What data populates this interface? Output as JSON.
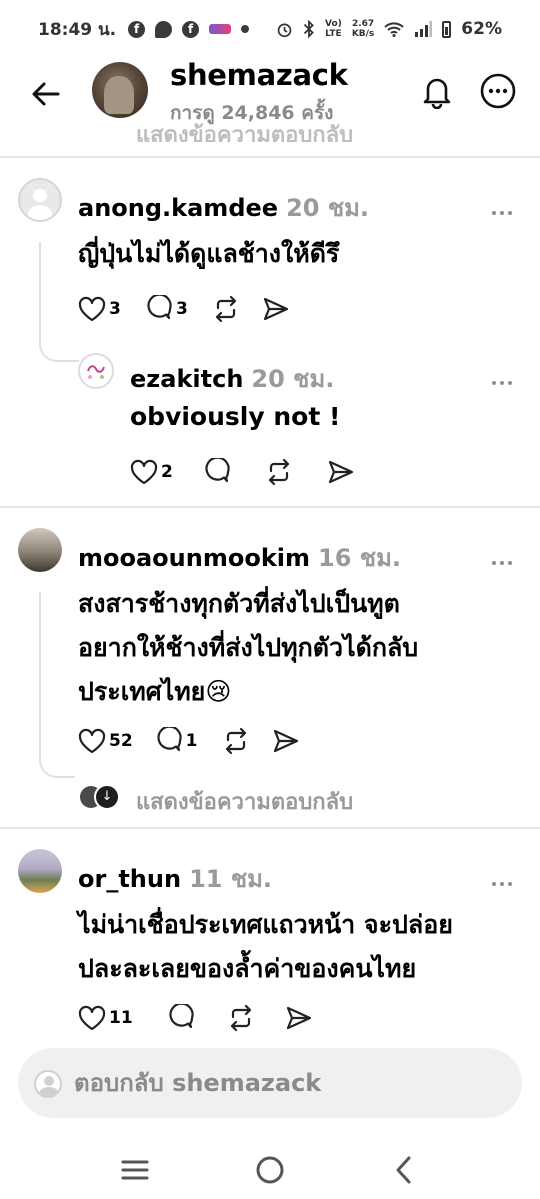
{
  "status_bar": {
    "time": "18:49 น.",
    "net_speed": "2.67",
    "net_unit": "KB/s",
    "lte": "LTE",
    "battery": "62%"
  },
  "header": {
    "title": "shemazack",
    "views": "การดู 24,846 ครั้ง"
  },
  "cut_text": "แสดงข้อความตอบกลับ",
  "comments": [
    {
      "username": "anong.kamdee",
      "time": "20 ชม.",
      "lines": [
        "ญี่ปุ่นไม่ได้ดูแลช้างให้ดีรึ"
      ],
      "likes": "3",
      "replies": "3"
    },
    {
      "username": "ezakitch",
      "time": "20 ชม.",
      "lines": [
        "obviously not !"
      ],
      "likes": "2",
      "replies": ""
    },
    {
      "username": "mooaounmookim",
      "time": "16 ชม.",
      "lines": [
        "สงสารช้างทุกตัวที่ส่งไปเป็นทูต",
        "อยากให้ช้างที่ส่งไปทุกตัวได้กลับ",
        "ประเทศไทย😢"
      ],
      "likes": "52",
      "replies": "1",
      "show_replies": "แสดงข้อความตอบกลับ"
    },
    {
      "username": "or_thun",
      "time": "11 ชม.",
      "lines": [
        "ไม่น่าเชื่อประเทศแถวหน้า จะปล่อย",
        "ปละละเลยของล้ำค่าของคนไทย"
      ],
      "likes": "11",
      "replies": ""
    }
  ],
  "reply_placeholder": "ตอบกลับ shemazack",
  "icons": {
    "back": "arrow-left-icon",
    "bell": "bell-icon",
    "more": "more-horizontal-icon",
    "like": "heart-icon",
    "comment": "comment-icon",
    "repost": "repost-icon",
    "share": "send-icon"
  },
  "colors": {
    "muted": "#9a9a9a",
    "divider": "#e6e6e6",
    "input_bg": "#f0f0f0"
  }
}
